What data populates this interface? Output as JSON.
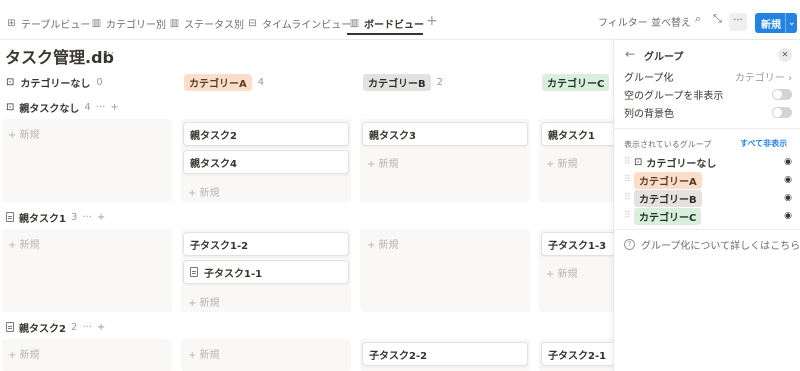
{
  "tabs": [
    {
      "label": "テーブルビュー",
      "icon": "table-icon"
    },
    {
      "label": "カテゴリー別",
      "icon": "board-icon"
    },
    {
      "label": "ステータス別",
      "icon": "board-icon"
    },
    {
      "label": "タイムラインビュー",
      "icon": "timeline-icon"
    },
    {
      "label": "ボードビュー",
      "icon": "board-icon",
      "active": true
    }
  ],
  "toolbar": {
    "filter": "フィルター",
    "sort": "並べ替え",
    "more": "···",
    "new": "新規"
  },
  "page": {
    "title": "タスク管理.db",
    "more": "···"
  },
  "columns": [
    {
      "label": "カテゴリーなし",
      "count": "0"
    },
    {
      "label": "カテゴリーA",
      "count": "4"
    },
    {
      "label": "カテゴリーB",
      "count": "2"
    },
    {
      "label": "カテゴリーC",
      "count": ""
    }
  ],
  "groups": [
    {
      "name": "親タスクなし",
      "count": "4"
    },
    {
      "name": "親タスク1",
      "count": "3"
    },
    {
      "name": "親タスク2",
      "count": "2"
    }
  ],
  "cards": {
    "g1_a1": "親タスク2",
    "g1_a2": "親タスク4",
    "g1_b1": "親タスク3",
    "g1_c1": "親タスク1",
    "g2_a1": "子タスク1-2",
    "g2_a2": "子タスク1-1",
    "g2_c1": "子タスク1-3",
    "g3_b1": "子タスク2-2",
    "g3_c1": "子タスク2-1"
  },
  "new_label": "+ 新規",
  "panel": {
    "title": "グループ",
    "group_by_label": "グループ化",
    "group_by_value": "カテゴリー",
    "hide_empty": "空のグループを非表示",
    "column_bg": "列の背景色",
    "shown_groups": "表示されているグループ",
    "hide_all": "すべて非表示",
    "groups": [
      "カテゴリーなし",
      "カテゴリーA",
      "カテゴリーB",
      "カテゴリーC"
    ],
    "help": "グループ化について詳しくはこちら"
  },
  "colors": {
    "accent": "#2383e2",
    "cat_a": "#fadec9",
    "cat_b": "#e3e2e0",
    "cat_c": "#dbeddb"
  }
}
